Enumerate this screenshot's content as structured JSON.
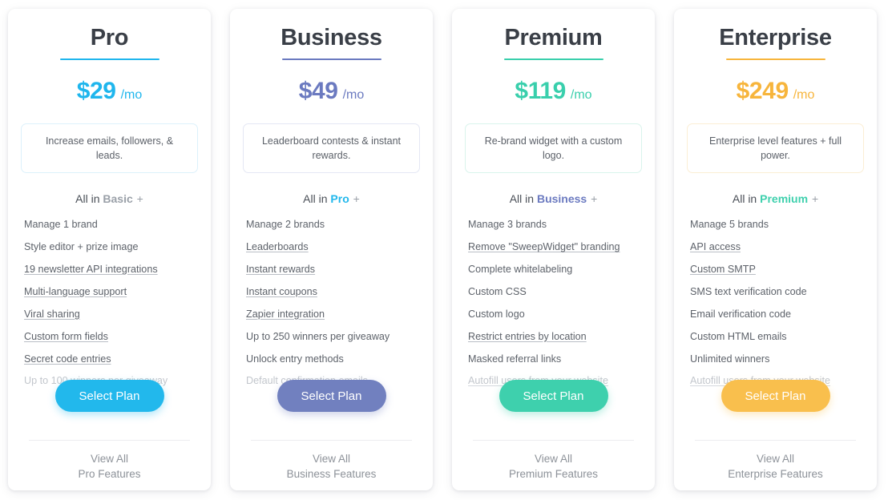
{
  "plans": [
    {
      "name": "Pro",
      "accent": "#1fb6ed",
      "desc_border": "#dcf1fb",
      "button_color": "#22b8ec",
      "price_amount": "$29",
      "price_period": "/mo",
      "description": "Increase emails, followers, & leads.",
      "all_in_prefix": "All in",
      "all_in_plan": "Basic",
      "all_in_plan_color": "#9aa0a8",
      "all_in_plus": "+",
      "features": [
        {
          "label": "Manage 1 brand",
          "linked": false,
          "muted": false
        },
        {
          "label": "Style editor + prize image",
          "linked": false,
          "muted": false
        },
        {
          "label": "19 newsletter API integrations",
          "linked": true,
          "muted": false
        },
        {
          "label": "Multi-language support",
          "linked": true,
          "muted": false
        },
        {
          "label": "Viral sharing",
          "linked": true,
          "muted": false
        },
        {
          "label": "Custom form fields",
          "linked": true,
          "muted": false
        },
        {
          "label": "Secret code entries",
          "linked": true,
          "muted": false
        },
        {
          "label": "Up to 100 winners per giveaway",
          "linked": false,
          "muted": true
        }
      ],
      "button_label": "Select Plan",
      "view_all_line1": "View All",
      "view_all_line2": "Pro Features"
    },
    {
      "name": "Business",
      "accent": "#6b7ac0",
      "desc_border": "#e4e7f4",
      "button_color": "#7180bf",
      "price_amount": "$49",
      "price_period": "/mo",
      "description": "Leaderboard contests & instant rewards.",
      "all_in_prefix": "All in",
      "all_in_plan": "Pro",
      "all_in_plan_color": "#22b8ec",
      "all_in_plus": "+",
      "features": [
        {
          "label": "Manage 2 brands",
          "linked": false,
          "muted": false
        },
        {
          "label": "Leaderboards",
          "linked": true,
          "muted": false
        },
        {
          "label": "Instant rewards",
          "linked": true,
          "muted": false
        },
        {
          "label": "Instant coupons",
          "linked": true,
          "muted": false
        },
        {
          "label": "Zapier integration",
          "linked": true,
          "muted": false
        },
        {
          "label": "Up to 250 winners per giveaway",
          "linked": false,
          "muted": false
        },
        {
          "label": "Unlock entry methods",
          "linked": false,
          "muted": false
        },
        {
          "label": "Default confirmation emails",
          "linked": false,
          "muted": true
        }
      ],
      "button_label": "Select Plan",
      "view_all_line1": "View All",
      "view_all_line2": "Business Features"
    },
    {
      "name": "Premium",
      "accent": "#39cfac",
      "desc_border": "#d9f4ec",
      "button_color": "#3ed0ad",
      "price_amount": "$119",
      "price_period": "/mo",
      "description": "Re-brand widget with a custom logo.",
      "all_in_prefix": "All in",
      "all_in_plan": "Business",
      "all_in_plan_color": "#6b7ac0",
      "all_in_plus": "+",
      "features": [
        {
          "label": "Manage 3 brands",
          "linked": false,
          "muted": false
        },
        {
          "label": "Remove \"SweepWidget\" branding",
          "linked": true,
          "muted": false
        },
        {
          "label": "Complete whitelabeling",
          "linked": false,
          "muted": false
        },
        {
          "label": "Custom CSS",
          "linked": false,
          "muted": false
        },
        {
          "label": "Custom logo",
          "linked": false,
          "muted": false
        },
        {
          "label": "Restrict entries by location",
          "linked": true,
          "muted": false
        },
        {
          "label": "Masked referral links",
          "linked": false,
          "muted": false
        },
        {
          "label": "Autofill users from your website",
          "linked": true,
          "muted": true
        }
      ],
      "button_label": "Select Plan",
      "view_all_line1": "View All",
      "view_all_line2": "Premium Features"
    },
    {
      "name": "Enterprise",
      "accent": "#f7b53c",
      "desc_border": "#fbeed4",
      "button_color": "#f9bf4d",
      "price_amount": "$249",
      "price_period": "/mo",
      "description": "Enterprise level features + full power.",
      "all_in_prefix": "All in",
      "all_in_plan": "Premium",
      "all_in_plan_color": "#3ed0ad",
      "all_in_plus": "+",
      "features": [
        {
          "label": "Manage 5 brands",
          "linked": false,
          "muted": false
        },
        {
          "label": "API access",
          "linked": true,
          "muted": false
        },
        {
          "label": "Custom SMTP",
          "linked": true,
          "muted": false
        },
        {
          "label": "SMS text verification code",
          "linked": false,
          "muted": false
        },
        {
          "label": "Email verification code",
          "linked": false,
          "muted": false
        },
        {
          "label": "Custom HTML emails",
          "linked": false,
          "muted": false
        },
        {
          "label": "Unlimited winners",
          "linked": false,
          "muted": false
        },
        {
          "label": "Autofill users from your website",
          "linked": true,
          "muted": true
        }
      ],
      "button_label": "Select Plan",
      "view_all_line1": "View All",
      "view_all_line2": "Enterprise Features"
    }
  ]
}
